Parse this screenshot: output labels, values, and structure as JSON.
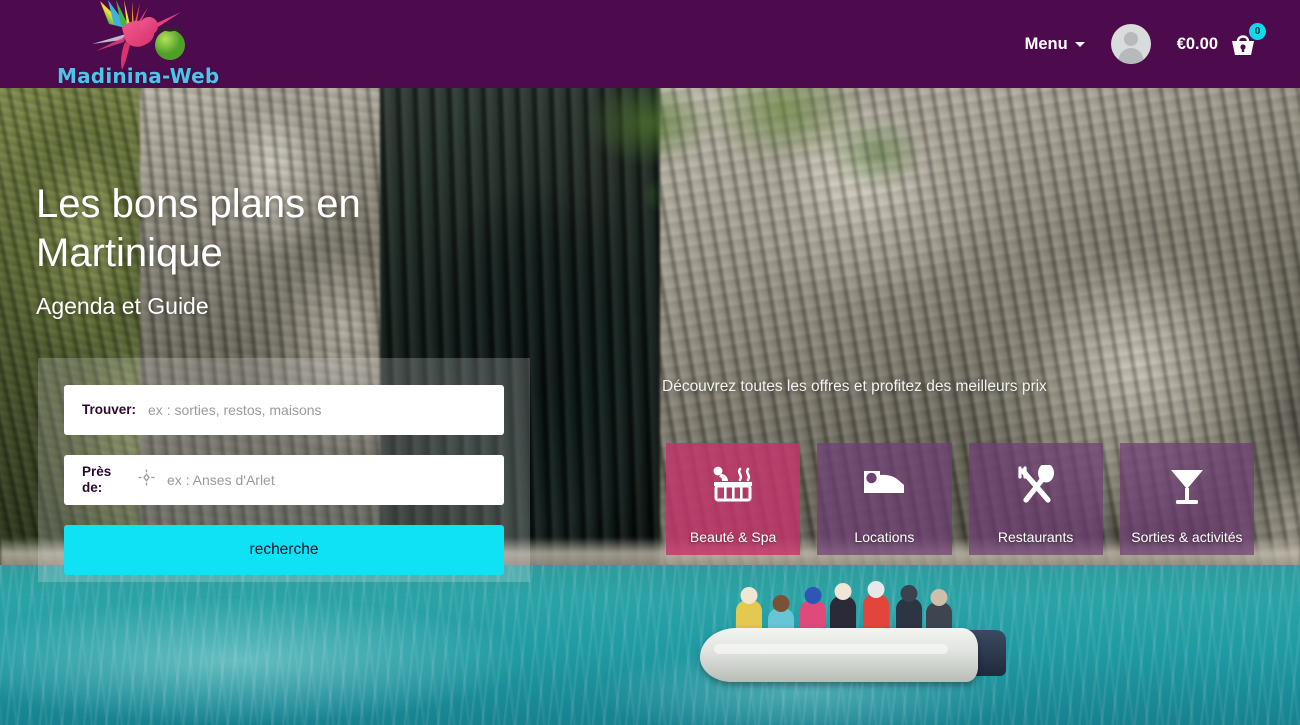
{
  "header": {
    "brand_word": "Madinina-Web",
    "brand_logo_icon": "hummingbird-logo-icon",
    "menu_label": "Menu",
    "menu_caret_icon": "chevron-down-icon",
    "avatar_icon": "user-avatar-icon",
    "cart_price": "€0.00",
    "cart_icon": "shopping-basket-icon",
    "cart_count": "0",
    "bg_color": "#4d0b4d",
    "brand_text_color": "#4fc3e8",
    "badge_color": "#0fd9ee"
  },
  "hero": {
    "title": "Les bons plans en Martinique",
    "subtitle": "Agenda et Guide"
  },
  "search": {
    "find_label": "Trouver:",
    "find_placeholder": "ex : sorties, restos, maisons",
    "find_value": "",
    "near_label": "Près de:",
    "near_placeholder": "ex : Anses d'Arlet",
    "near_value": "",
    "geo_icon": "crosshair-locate-icon",
    "button_label": "recherche",
    "button_color": "#0fe2f5"
  },
  "promo": {
    "text": "Découvrez toutes les offres et profitez des meilleurs prix"
  },
  "categories": [
    {
      "label": "Beauté & Spa",
      "icon": "hot-tub-spa-icon",
      "color": "#c4356b"
    },
    {
      "label": "Locations",
      "icon": "bed-lodging-icon",
      "color": "#6f3f75"
    },
    {
      "label": "Restaurants",
      "icon": "fork-spoon-icon",
      "color": "#6f3f75"
    },
    {
      "label": "Sorties & activités",
      "icon": "cocktail-glass-icon",
      "color": "#6f3f75"
    }
  ]
}
